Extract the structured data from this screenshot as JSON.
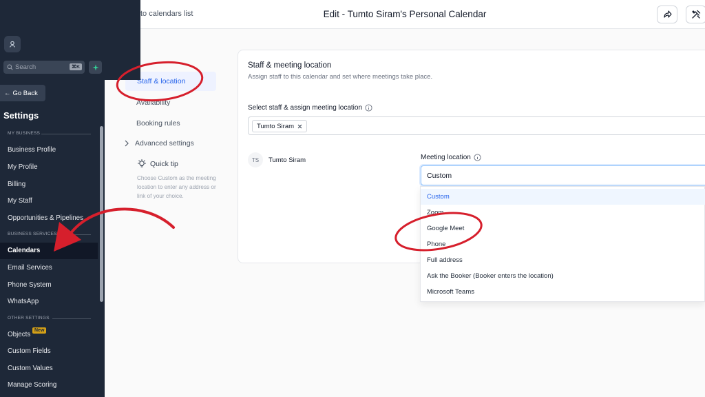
{
  "topbar": {
    "back_label": "to calendars list",
    "title": "Edit - Tumto Siram's Personal Calendar"
  },
  "subnav": {
    "items": [
      "Staff & location",
      "Availability",
      "Booking rules",
      "Advanced settings"
    ],
    "tip_title": "Quick tip",
    "tip_text": "Choose Custom as the meeting location to enter any address or link of your choice."
  },
  "card": {
    "title": "Staff & meeting location",
    "subtitle": "Assign staff to this calendar and set where meetings take place.",
    "select_label": "Select staff & assign meeting location",
    "chip": "Tumto Siram",
    "avatar_initials": "TS",
    "staff_name": "Tumto Siram",
    "location_label": "Meeting location",
    "location_value": "Custom"
  },
  "dropdown": {
    "options": [
      "Custom",
      "Zoom",
      "Google Meet",
      "Phone",
      "Full address",
      "Ask the Booker (Booker enters the location)",
      "Microsoft Teams"
    ],
    "selected": "Custom"
  },
  "sidebar": {
    "search_placeholder": "Search",
    "search_shortcut": "⌘K",
    "go_back": "Go Back",
    "settings_title": "Settings",
    "section_my_business": "MY BUSINESS",
    "my_business_items": [
      "Business Profile",
      "My Profile",
      "Billing",
      "My Staff",
      "Opportunities & Pipelines"
    ],
    "section_business_services": "BUSINESS SERVICES",
    "business_services_items": [
      "Calendars",
      "Email Services",
      "Phone System",
      "WhatsApp"
    ],
    "section_other_settings": "OTHER SETTINGS",
    "other_settings_items": [
      "Objects",
      "Custom Fields",
      "Custom Values",
      "Manage Scoring"
    ],
    "new_badge": "New"
  },
  "colors": {
    "sidebar_bg": "#1e2838",
    "accent": "#2563eb",
    "annotation": "#d61f2c"
  }
}
